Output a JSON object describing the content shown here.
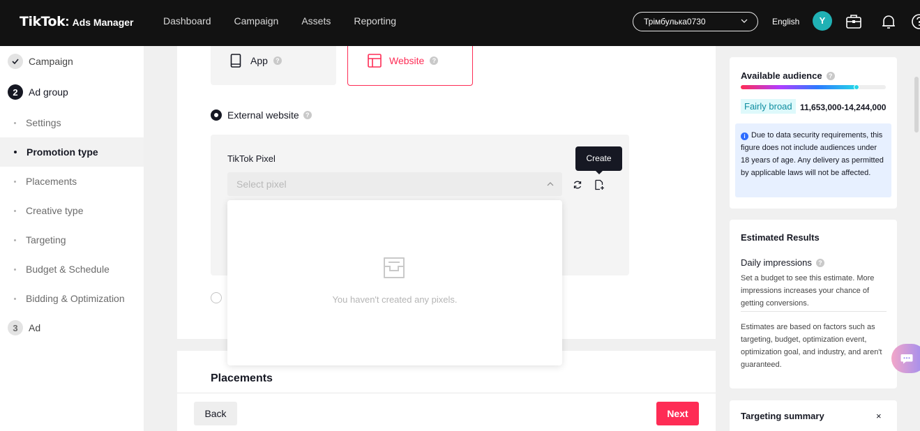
{
  "topbar": {
    "logo_brand": "TikTok",
    "logo_sep": ":",
    "logo_product": "Ads Manager",
    "nav": [
      "Dashboard",
      "Campaign",
      "Assets",
      "Reporting"
    ],
    "account": "Трімбулька0730",
    "language": "English",
    "avatar_initial": "Y"
  },
  "sidebar": {
    "steps": [
      {
        "label": "Campaign",
        "state": "done"
      },
      {
        "number": "2",
        "label": "Ad group",
        "state": "current"
      },
      {
        "number": "3",
        "label": "Ad",
        "state": "pending"
      }
    ],
    "sub_items": [
      "Settings",
      "Promotion type",
      "Placements",
      "Creative type",
      "Targeting",
      "Budget & Schedule",
      "Bidding & Optimization"
    ],
    "active_sub": "Promotion type"
  },
  "promotion": {
    "app_label": "App",
    "website_label": "Website",
    "external_website_label": "External website",
    "pixel_title": "TikTok Pixel",
    "pixel_placeholder": "Select pixel",
    "create_tooltip": "Create",
    "empty_text": "You haven't created any pixels."
  },
  "placements_title": "Placements",
  "footer": {
    "back_label": "Back",
    "next_label": "Next"
  },
  "audience": {
    "title": "Available audience",
    "level_fraction": 0.8,
    "badge": "Fairly broad",
    "range": "11,653,000-14,244,000",
    "info": "Due to data security requirements, this figure does not include audiences under 18 years of age. Any delivery as permitted by applicable laws will not be affected."
  },
  "estimated": {
    "title": "Estimated Results",
    "daily_title": "Daily impressions",
    "daily_text": "Set a budget to see this estimate. More impressions increases your chance of getting conversions.",
    "disclaimer": "Estimates are based on factors such as targeting, budget, optimization event, optimization goal, and industry, and aren't guaranteed."
  },
  "targeting_summary": {
    "title": "Targeting summary",
    "close_glyph": "×"
  },
  "colors": {
    "accent": "#fe2c55",
    "teal": "#20b1b4",
    "info_blue": "#2d6cff"
  }
}
